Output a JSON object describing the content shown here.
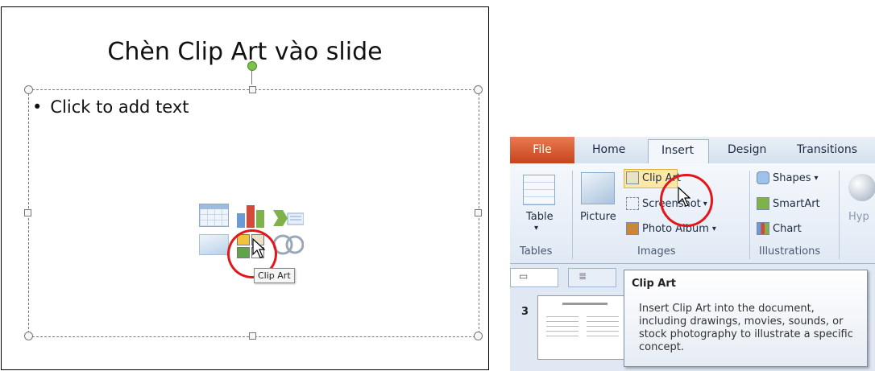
{
  "slide": {
    "title": "Chèn Clip Art vào slide",
    "bullet": "Click to add text",
    "content_icons": [
      "table-icon",
      "chart-icon",
      "smartart-icon",
      "picture-icon",
      "clip-art-icon",
      "media-icon"
    ],
    "tooltip": "Clip Art"
  },
  "ribbon": {
    "tabs": {
      "file": "File",
      "home": "Home",
      "insert": "Insert",
      "design": "Design",
      "transitions": "Transitions"
    },
    "tables_group": {
      "table_label": "Table",
      "group_label": "Tables"
    },
    "images_group": {
      "picture_label": "Picture",
      "clip_art_label": "Clip Art",
      "screenshot_label": "Screenshot",
      "photo_album_label": "Photo Album",
      "group_label": "Images"
    },
    "illustrations_group": {
      "shapes_label": "Shapes",
      "smartart_label": "SmartArt",
      "chart_label": "Chart",
      "group_label": "Illustrations"
    },
    "hyperlink_partial": "Hyp",
    "slide_number": "3"
  },
  "supertip": {
    "title": "Clip Art",
    "body": "Insert Clip Art into the document, including drawings, movies, sounds, or stock photography to illustrate a specific concept."
  },
  "colors": {
    "highlight_circle": "#e3161b",
    "file_tab": "#c8441d",
    "hover": "#fde9a5"
  }
}
